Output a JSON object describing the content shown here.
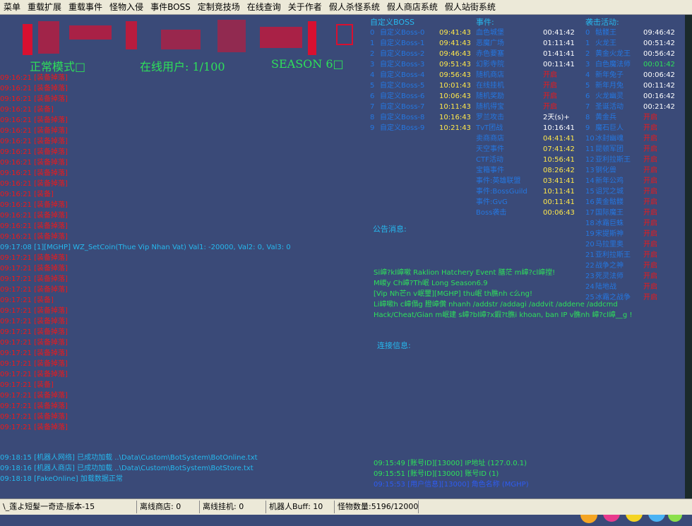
{
  "menu": [
    "菜单",
    "重载扩展",
    "重载事件",
    "怪物入侵",
    "事件BOSS",
    "定制竞技场",
    "在线查询",
    "关于作者",
    "假人杀怪系统",
    "假人商店系统",
    "假人站街系统"
  ],
  "mode": {
    "left": "正常模式□",
    "center": "在线用户: 1/100",
    "right": "SEASON 6□"
  },
  "log": {
    "red_top": [
      "09:16:21 [装备掉落]",
      "09:16:21 [装备掉落]",
      "09:16:21 [装备掉落]",
      "09:16:21 [装备]",
      "09:16:21 [装备掉落]",
      "09:16:21 [装备掉落]",
      "09:16:21 [装备掉落]",
      "09:16:21 [装备掉落]",
      "09:16:21 [装备掉落]",
      "09:16:21 [装备掉落]",
      "09:16:21 [装备掉落]",
      "09:16:21 [装备]",
      "09:16:21 [装备掉落]",
      "09:16:21 [装备掉落]",
      "09:16:21 [装备掉落]",
      "09:16:21 [装备掉落]"
    ],
    "cyan_line": "09:17:08 [1][MGHP] WZ_SetCoin(Thue Vip Nhan Vat) Val1: -20000, Val2: 0, Val3: 0",
    "red_bottom": [
      "09:17:21 [装备掉落]",
      "09:17:21 [装备掉落]",
      "09:17:21 [装备掉落]",
      "09:17:21 [装备掉落]",
      "09:17:21 [装备]",
      "09:17:21 [装备掉落]",
      "09:17:21 [装备掉落]",
      "09:17:21 [装备掉落]",
      "09:17:21 [装备掉落]",
      "09:17:21 [装备掉落]",
      "09:17:21 [装备掉落]",
      "09:17:21 [装备掉落]",
      "09:17:21 [装备]",
      "09:17:21 [装备掉落]",
      "09:17:21 [装备掉落]",
      "09:17:21 [装备掉落]",
      "09:17:21 [装备掉落]"
    ],
    "bottom": [
      "09:18:15 [机器人网络] 已成功加载 ..\\Data\\Custom\\BotSystem\\BotOnline.txt",
      "09:18:16 [机器人商店] 已成功加载 ..\\Data\\Custom\\BotSystem\\BotStore.txt",
      "09:18:18 [FakeOnline] 加载数据正常"
    ]
  },
  "boss": {
    "title": "自定义BOSS",
    "rows": [
      [
        "0",
        "自定义Boss-0",
        "09:41:43"
      ],
      [
        "1",
        "自定义Boss-1",
        "09:41:43"
      ],
      [
        "2",
        "自定义Boss-2",
        "09:46:43"
      ],
      [
        "3",
        "自定义Boss-3",
        "09:51:43"
      ],
      [
        "4",
        "自定义Boss-4",
        "09:56:43"
      ],
      [
        "5",
        "自定义Boss-5",
        "10:01:43"
      ],
      [
        "6",
        "自定义Boss-6",
        "10:06:43"
      ],
      [
        "7",
        "自定义Boss-7",
        "10:11:43"
      ],
      [
        "8",
        "自定义Boss-8",
        "10:16:43"
      ],
      [
        "9",
        "自定义Boss-9",
        "10:21:43"
      ]
    ]
  },
  "events": {
    "title": "事件:",
    "rows": [
      [
        "血色城堡",
        "00:41:42",
        "w"
      ],
      [
        "恶魔广场",
        "01:11:41",
        "w"
      ],
      [
        "赤色要塞",
        "01:41:41",
        "w"
      ],
      [
        "幻影寺院",
        "00:11:41",
        "w"
      ],
      [
        "随机商店",
        "开启",
        "r"
      ],
      [
        "在线挂机",
        "开启",
        "r"
      ],
      [
        "随机奖励",
        "开启",
        "r"
      ],
      [
        "随机得宝",
        "开启",
        "r"
      ],
      [
        "罗兰攻击",
        "2天(s)+",
        "w"
      ],
      [
        "TvT团战",
        "10:16:41",
        "w"
      ],
      [
        "卖商商店",
        "04:41:41",
        "y"
      ],
      [
        "天空事件",
        "07:41:42",
        "y"
      ],
      [
        "CTF活动",
        "10:56:41",
        "y"
      ],
      [
        "宝箱事件",
        "08:26:42",
        "y"
      ],
      [
        "事件:英雄联盟",
        "03:41:41",
        "y"
      ],
      [
        "事件:BossGuild",
        "10:11:41",
        "y"
      ],
      [
        "事件:GvG",
        "00:11:41",
        "y"
      ],
      [
        "Boss袭击",
        "00:06:43",
        "y"
      ]
    ]
  },
  "invasion": {
    "title": "袭击活动:",
    "rows": [
      [
        "0",
        "骷髅王",
        "09:46:42",
        "w"
      ],
      [
        "1",
        "火龙王",
        "00:51:42",
        "w"
      ],
      [
        "2",
        "黄金火龙王",
        "00:56:42",
        "w"
      ],
      [
        "3",
        "白色魔法师",
        "00:01:42",
        "g"
      ],
      [
        "4",
        "新年兔子",
        "00:06:42",
        "w"
      ],
      [
        "5",
        "新年月兔",
        "00:11:42",
        "w"
      ],
      [
        "6",
        "火龙幽灵",
        "00:16:42",
        "w"
      ],
      [
        "7",
        "圣诞活动",
        "00:21:42",
        "w"
      ],
      [
        "8",
        "黄金兵",
        "开启",
        "r"
      ],
      [
        "9",
        "魔石巨人",
        "开启",
        "r"
      ],
      [
        "10",
        "冰封幽魂",
        "开启",
        "r"
      ],
      [
        "11",
        "昆顿军团",
        "开启",
        "r"
      ],
      [
        "12",
        "亚利拉斯王",
        "开启",
        "r"
      ],
      [
        "13",
        "钢化兽",
        "开启",
        "r"
      ],
      [
        "14",
        "新年公鸡",
        "开启",
        "r"
      ],
      [
        "15",
        "诅咒之城",
        "开启",
        "r"
      ],
      [
        "16",
        "黄金骷髅",
        "开启",
        "r"
      ],
      [
        "17",
        "国际魔王",
        "开启",
        "r"
      ],
      [
        "18",
        "冰霜巨蛛",
        "开启",
        "r"
      ],
      [
        "19",
        "宋提斯神",
        "开启",
        "r"
      ],
      [
        "20",
        "马拉里奥",
        "开启",
        "r"
      ],
      [
        "21",
        "亚利拉斯王",
        "开启",
        "r"
      ],
      [
        "22",
        "战争之神",
        "开启",
        "r"
      ],
      [
        "23",
        "死灵法师",
        "开启",
        "r"
      ],
      [
        "24",
        "陆地战",
        "开启",
        "r"
      ],
      [
        "25",
        "冰霜之战争",
        "开启",
        "r"
      ]
    ]
  },
  "announce": {
    "title": "公告消息:",
    "lines": [
      "Si嶂?kl嶂嗽 Raklion Hatchery Event 膳茫 m嶂?cl嶂摚!",
      "M嵕y Ch嶂?Th岷    Long Season6.9",
      "[Vip Nh芒n v岷璽][MGHP] thu岷 th膲nh c么ng!",
      "Li嶂嗽h c嶂傝g 膯嶂儹 nhanh /addstr /addagi /addvit /addene /addcmd",
      "Hack/Cheat/Gian m岷建 s嶂?bl嶂?x鍜?t膲i khoan,  ban IP v膲nh  嶂?cl嶂__g !"
    ]
  },
  "connection": {
    "title": "连接信息:",
    "lines": [
      "09:15:49 [账号ID][13000] IP地址 (127.0.0.1)",
      "09:15:51 [账号ID][13000] 账号ID (1)",
      "09:15:53 [用户信息][13000] 角色名称 (MGHP)"
    ]
  },
  "status": [
    "\\_莲よ短髮一奇迹-版本-15",
    "离线商店: 0",
    "离线挂机: 0",
    "机器人Buff: 10",
    "怪物数量:5196/12000"
  ],
  "colors": {
    "bg": "#3a4a78",
    "red": "#f01818",
    "cyan": "#26b8ee",
    "green": "#2ee05a",
    "yellow": "#ffe84a"
  }
}
